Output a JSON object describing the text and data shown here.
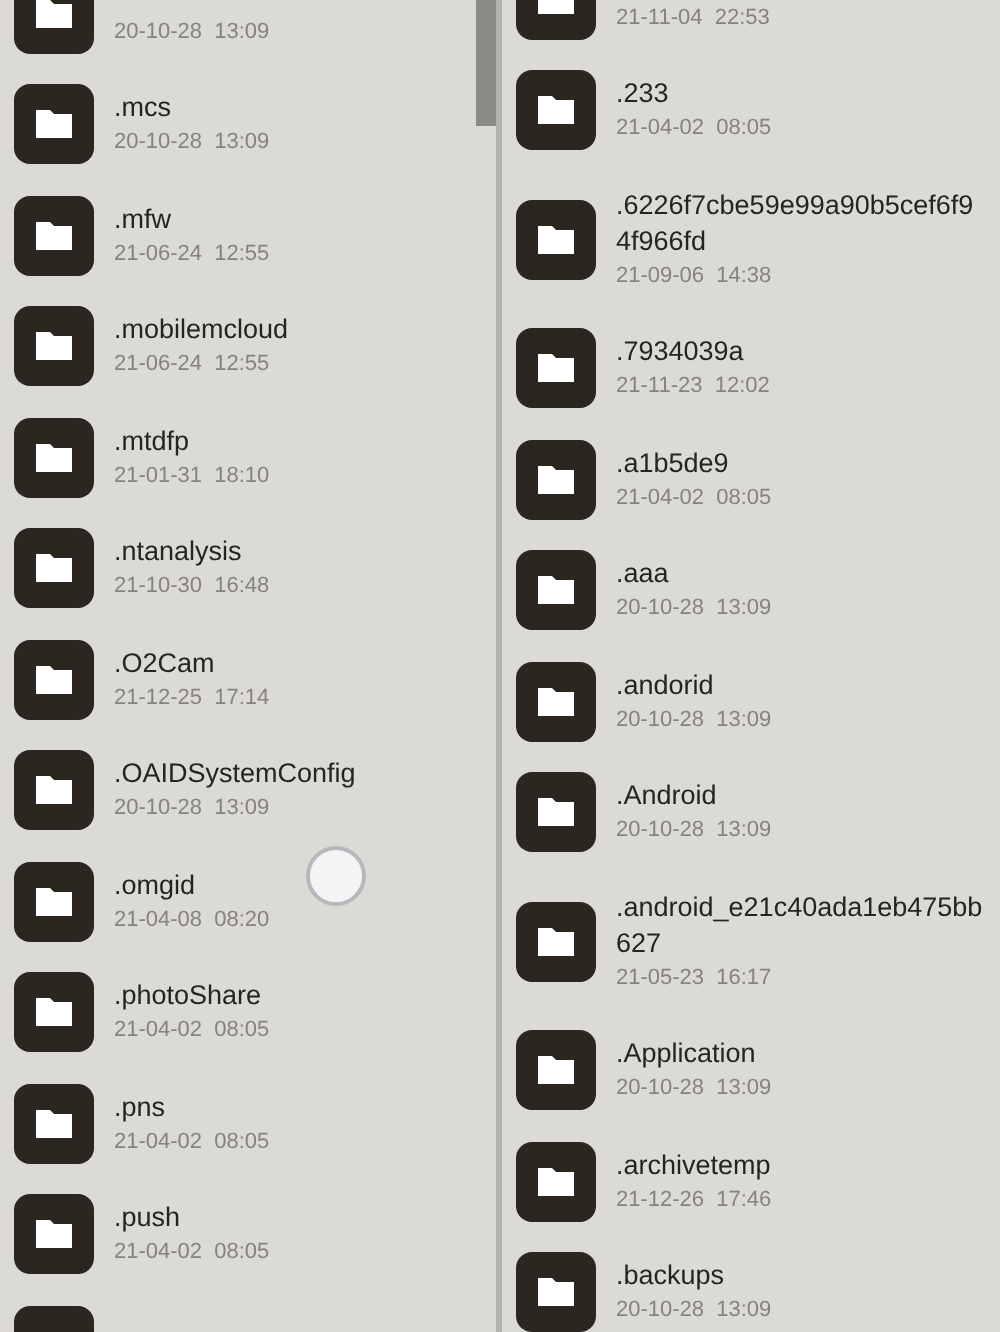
{
  "panes": [
    {
      "items": [
        {
          "kind": "folder",
          "date": "20-10-28  13:09"
        },
        {
          "kind": "folder",
          "name": ".mcs",
          "date": "20-10-28  13:09"
        },
        {
          "kind": "folder",
          "name": ".mfw",
          "date": "21-06-24  12:55"
        },
        {
          "kind": "folder",
          "name": ".mobilemcloud",
          "date": "21-06-24  12:55"
        },
        {
          "kind": "folder",
          "name": ".mtdfp",
          "date": "21-01-31  18:10"
        },
        {
          "kind": "folder",
          "name": ".ntanalysis",
          "date": "21-10-30  16:48"
        },
        {
          "kind": "folder",
          "name": ".O2Cam",
          "date": "21-12-25  17:14"
        },
        {
          "kind": "folder",
          "name": ".OAIDSystemConfig",
          "date": "20-10-28  13:09"
        },
        {
          "kind": "folder",
          "name": ".omgid",
          "date": "21-04-08  08:20"
        },
        {
          "kind": "folder",
          "name": ".photoShare",
          "date": "21-04-02  08:05"
        },
        {
          "kind": "folder",
          "name": ".pns",
          "date": "21-04-02  08:05"
        },
        {
          "kind": "folder",
          "name": ".push",
          "date": "21-04-02  08:05"
        },
        {
          "kind": "folder"
        }
      ]
    },
    {
      "items": [
        {
          "kind": "folder",
          "date": "21-11-04  22:53"
        },
        {
          "kind": "folder",
          "name": ".233",
          "date": "21-04-02  08:05"
        },
        {
          "kind": "folder",
          "name": ".6226f7cbe59e99a90b5cef6f94f966fd",
          "date": "21-09-06  14:38"
        },
        {
          "kind": "folder",
          "name": ".7934039a",
          "date": "21-11-23  12:02"
        },
        {
          "kind": "folder",
          "name": ".a1b5de9",
          "date": "21-04-02  08:05"
        },
        {
          "kind": "folder",
          "name": ".aaa",
          "date": "20-10-28  13:09"
        },
        {
          "kind": "folder",
          "name": ".andorid",
          "date": "20-10-28  13:09"
        },
        {
          "kind": "folder",
          "name": ".Android",
          "date": "20-10-28  13:09"
        },
        {
          "kind": "folder",
          "name": ".android_e21c40ada1eb475bb627",
          "date": "21-05-23  16:17"
        },
        {
          "kind": "folder",
          "name": ".Application",
          "date": "20-10-28  13:09"
        },
        {
          "kind": "folder",
          "name": ".archivetemp",
          "date": "21-12-26  17:46"
        },
        {
          "kind": "folder",
          "name": ".backups",
          "date": "20-10-28  13:09"
        }
      ]
    }
  ]
}
